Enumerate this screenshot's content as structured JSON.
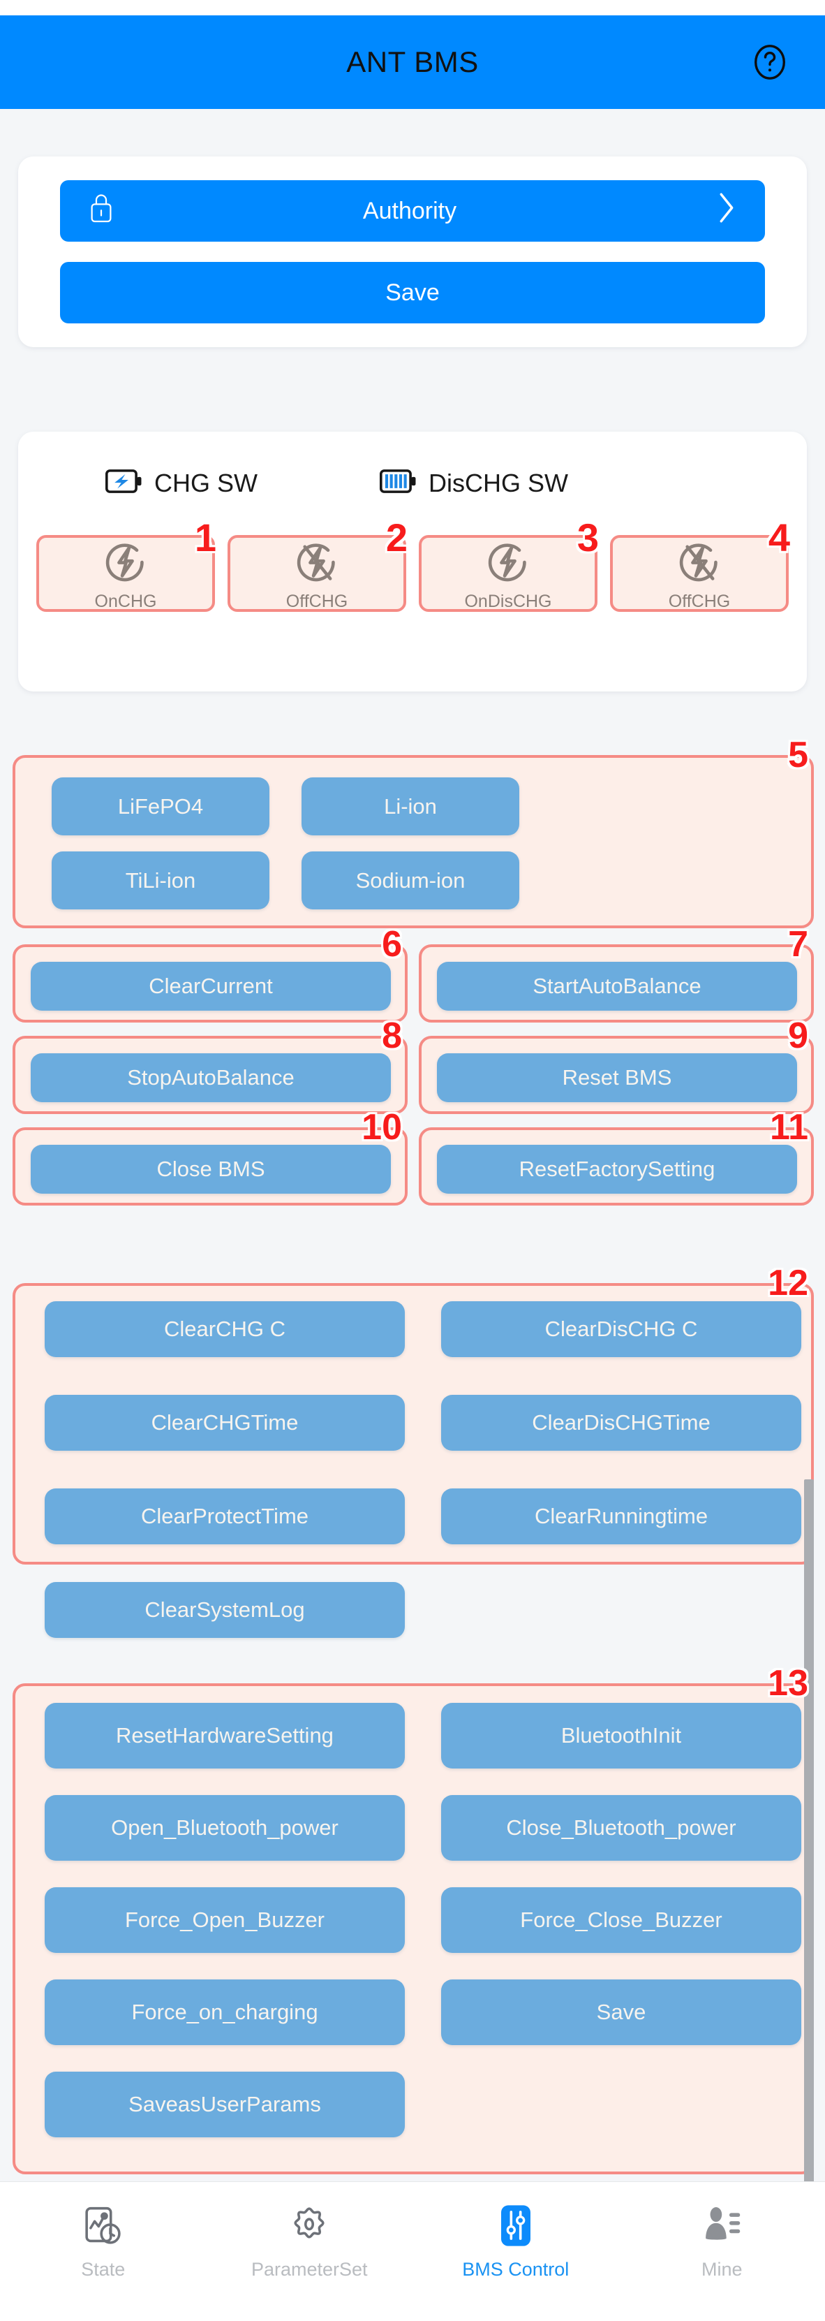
{
  "header": {
    "title": "ANT BMS",
    "help_icon": "question-circle-icon",
    "bg_color": "#0089ff"
  },
  "top_card": {
    "authority": {
      "label": "Authority",
      "lock_icon": "lock-icon",
      "chevron_icon": "chevron-right-icon"
    },
    "save": {
      "label": "Save"
    }
  },
  "switch_card": {
    "chg": {
      "label": "CHG SW",
      "icon": "battery-charging-icon"
    },
    "dischg": {
      "label": "DisCHG SW",
      "icon": "battery-full-icon"
    },
    "buttons": [
      {
        "label": "OnCHG",
        "icon": "power-bolt-icon",
        "annotation": "1"
      },
      {
        "label": "OffCHG",
        "icon": "power-bolt-slash-icon",
        "annotation": "2"
      },
      {
        "label": "OnDisCHG",
        "icon": "power-bolt-icon",
        "annotation": "3"
      },
      {
        "label": "OffCHG",
        "icon": "power-bolt-slash-icon",
        "annotation": "4"
      }
    ]
  },
  "groups": [
    {
      "annotation": "5",
      "buttons": [
        {
          "label": "LiFePO4"
        },
        {
          "label": "Li-ion"
        },
        {
          "label": "TiLi-ion"
        },
        {
          "label": "Sodium-ion"
        }
      ]
    },
    {
      "annotation": "6",
      "buttons": [
        {
          "label": "ClearCurrent"
        }
      ]
    },
    {
      "annotation": "7",
      "buttons": [
        {
          "label": "StartAutoBalance"
        }
      ]
    },
    {
      "annotation": "8",
      "buttons": [
        {
          "label": "StopAutoBalance"
        }
      ]
    },
    {
      "annotation": "9",
      "buttons": [
        {
          "label": "Reset BMS"
        }
      ]
    },
    {
      "annotation": "10",
      "buttons": [
        {
          "label": "Close BMS"
        }
      ]
    },
    {
      "annotation": "11",
      "buttons": [
        {
          "label": "ResetFactorySetting"
        }
      ]
    },
    {
      "annotation": "12",
      "buttons": [
        {
          "label": "ClearCHG C"
        },
        {
          "label": "ClearDisCHG C"
        },
        {
          "label": "ClearCHGTime"
        },
        {
          "label": "ClearDisCHGTime"
        },
        {
          "label": "ClearProtectTime"
        },
        {
          "label": "ClearRunningtime"
        },
        {
          "label": "ClearSystemLog"
        }
      ]
    },
    {
      "annotation": "13",
      "buttons": [
        {
          "label": "ResetHardwareSetting"
        },
        {
          "label": "BluetoothInit"
        },
        {
          "label": "Open_Bluetooth_power"
        },
        {
          "label": "Close_Bluetooth_power"
        },
        {
          "label": "Force_Open_Buzzer"
        },
        {
          "label": "Force_Close_Buzzer"
        },
        {
          "label": "Force_on_charging"
        },
        {
          "label": "Save"
        },
        {
          "label": "SaveasUserParams"
        }
      ]
    }
  ],
  "bottom_nav": {
    "items": [
      {
        "label": "State",
        "icon": "chart-clock-icon",
        "active": false
      },
      {
        "label": "ParameterSet",
        "icon": "gear-icon",
        "active": false
      },
      {
        "label": "BMS Control",
        "icon": "sliders-icon",
        "active": true
      },
      {
        "label": "Mine",
        "icon": "user-list-icon",
        "active": false
      }
    ],
    "active_color": "#1a92f2",
    "inactive_color": "#b9bcc0"
  },
  "colors": {
    "header_blue": "#0089ff",
    "button_blue": "#6bacde",
    "annotation_red": "#f71c1c",
    "annotation_border": "#f58b85",
    "annotation_fill": "#fdeee8",
    "page_bg": "#f4f6f8"
  }
}
